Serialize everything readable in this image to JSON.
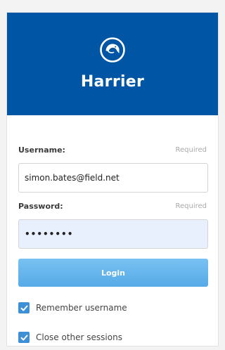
{
  "brand": {
    "name": "Harrier",
    "logo_icon": "bird-logo-icon",
    "header_color": "#0055a5"
  },
  "username": {
    "label": "Username:",
    "required_hint": "Required",
    "value": "simon.bates@field.net"
  },
  "password": {
    "label": "Password:",
    "required_hint": "Required",
    "masked_value": "••••••••"
  },
  "login_button": {
    "label": "Login",
    "color": "#62b3ec"
  },
  "options": [
    {
      "label": "Remember username",
      "checked": true
    },
    {
      "label": "Close other sessions",
      "checked": true
    }
  ]
}
